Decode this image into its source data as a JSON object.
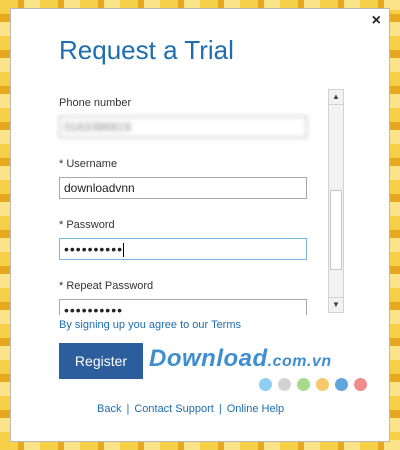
{
  "dialog": {
    "title": "Request a Trial",
    "close_glyph": "×"
  },
  "form": {
    "fields": [
      {
        "label": "Phone number",
        "value": "0163386819"
      },
      {
        "label": "* Username",
        "value": "downloadvnn"
      },
      {
        "label": "* Password",
        "value": "••••••••••"
      },
      {
        "label": "* Repeat Password",
        "value": "••••••••••"
      }
    ]
  },
  "scrollbar": {
    "up_glyph": "▲",
    "down_glyph": "▼"
  },
  "terms_text": "By signing up you agree to our Terms",
  "register_label": "Register",
  "watermark": {
    "brand": "Download",
    "suffix": ".com.vn",
    "dot_colors": [
      "#8ccff2",
      "#d3d3d3",
      "#a9d98a",
      "#f9c86a",
      "#5ea6dc",
      "#f08b8b"
    ]
  },
  "footer_links": {
    "back": "Back",
    "contact": "Contact Support",
    "help": "Online Help",
    "separator": "|"
  },
  "colors": {
    "accent": "#1d6db0",
    "button": "#2c5e9e"
  }
}
